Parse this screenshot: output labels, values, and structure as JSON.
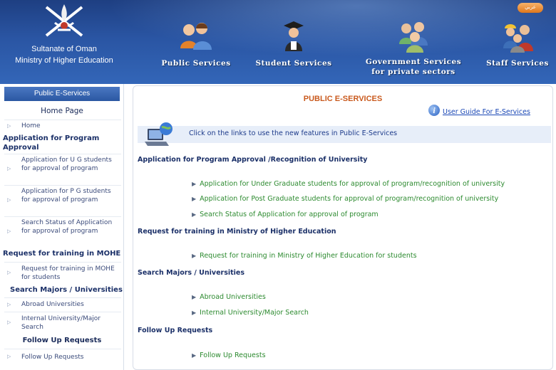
{
  "header": {
    "org_line1": "Sultanate of Oman",
    "org_line2": "Ministry of Higher Education",
    "nav": {
      "public": "Public Services",
      "student": "Student Services",
      "gov_line1": "Government Services",
      "gov_line2": "for private sectors",
      "staff": "Staff Services"
    },
    "lang_label": "عربي"
  },
  "sidebar": {
    "header": "Public E-Services",
    "home_title": "Home Page",
    "home": "Home",
    "section1": "Application for Program Approval",
    "app_ug": "Application for U G students for approval of program",
    "app_pg": "Application for P G students for approval of program",
    "search_status": "Search Status of Application for approval of program",
    "section2": "Request for training in MOHE",
    "req_training": "Request for training in MOHE for students",
    "section3": "Search Majors / Universities",
    "abroad": "Abroad Universities",
    "internal": "Internal University/Major Search",
    "section4": "Follow Up Requests",
    "follow_up": "Follow Up Requests"
  },
  "main": {
    "title": "PUBLIC E-SERVICES",
    "guide_link": "User Guide For E-Services",
    "intro": "Click on the links to use the new features in Public E-Services",
    "sections": [
      {
        "heading": "Application for Program Approval /Recognition of University",
        "items": [
          "Application for Under Graduate students for approval of program/recognition of university",
          "Application for Post Graduate students for approval of program/recognition of university",
          "Search Status of Application for approval of program"
        ]
      },
      {
        "heading": "Request for training in Ministry of Higher Education",
        "items": [
          "Request for training in Ministry of Higher Education for students"
        ]
      },
      {
        "heading": "Search Majors / Universities",
        "items": [
          "Abroad Universities",
          "Internal University/Major Search"
        ]
      },
      {
        "heading": "Follow Up Requests",
        "items": [
          "Follow Up Requests"
        ]
      }
    ]
  },
  "colors": {
    "header_blue": "#2a55a3",
    "title_orange": "#c95a1e",
    "link_green": "#2c8a2f",
    "heading_navy": "#1b3068",
    "guide_blue": "#1a47b5"
  },
  "icons": [
    "oman-emblem-icon",
    "public-services-people-icon",
    "student-graduate-icon",
    "government-services-people-icon",
    "staff-workers-icon",
    "info-icon",
    "laptop-globe-icon",
    "arrow-bullet-icon"
  ]
}
